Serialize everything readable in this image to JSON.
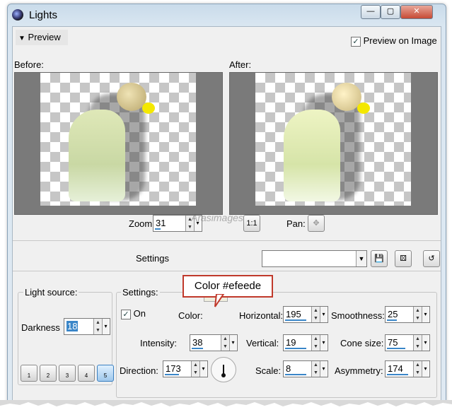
{
  "window": {
    "title": "Lights"
  },
  "titlebar_buttons": {
    "minimize": "—",
    "maximize": "▢",
    "close": "✕"
  },
  "preview": {
    "toggle_label": "Preview",
    "preview_on_image_label": "Preview on Image",
    "preview_on_image_checked": true,
    "before_label": "Before:",
    "after_label": "After:",
    "zoom_label": "Zoom:",
    "zoom_value": "31",
    "zoom_fill": 0.31,
    "actual_size_button": "1:1",
    "pan_label": "Pan:",
    "pan_icon": "move-icon"
  },
  "settings_bar": {
    "label": "Settings",
    "preset_value": "",
    "save_icon": "save-icon",
    "random_icon": "dice-icon",
    "reset_icon": "reset-icon"
  },
  "annotation": {
    "callout_text": "Color #efeede",
    "color": "#efeede",
    "accent": "#c0392b"
  },
  "light_source": {
    "group_label": "Light source:",
    "darkness_label": "Darkness",
    "darkness_value": "18",
    "buttons": [
      "1",
      "2",
      "3",
      "4",
      "5"
    ],
    "active_button": "5"
  },
  "settings": {
    "group_label": "Settings:",
    "on_label": "On",
    "on_checked": true,
    "color_label": "Color:",
    "color": "#efeede",
    "intensity_label": "Intensity:",
    "intensity_value": "38",
    "direction_label": "Direction:",
    "direction_value": "173",
    "horizontal_label": "Horizontal:",
    "horizontal_value": "195",
    "vertical_label": "Vertical:",
    "vertical_value": "19",
    "scale_label": "Scale:",
    "scale_value": "8",
    "smoothness_label": "Smoothness:",
    "smoothness_value": "25",
    "cone_size_label": "Cone size:",
    "cone_size_value": "75",
    "asymmetry_label": "Asymmetry:",
    "asymmetry_value": "174"
  },
  "watermark": {
    "text": "Arasimages"
  }
}
